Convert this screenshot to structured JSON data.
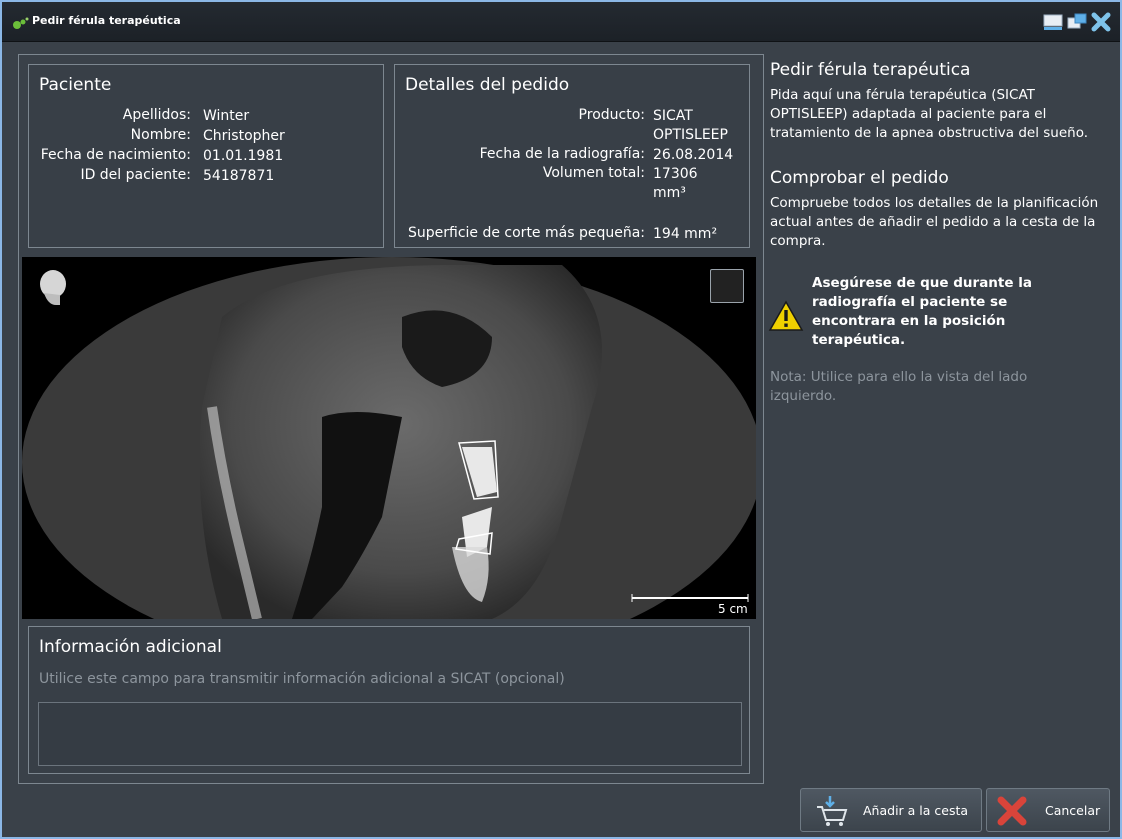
{
  "window": {
    "title": "Pedir férula terapéutica"
  },
  "patient": {
    "heading": "Paciente",
    "rows": [
      {
        "label": "Apellidos:",
        "value": "Winter"
      },
      {
        "label": "Nombre:",
        "value": "Christopher"
      },
      {
        "label": "Fecha de nacimiento:",
        "value": "01.01.1981"
      },
      {
        "label": "ID del paciente:",
        "value": "54187871"
      }
    ]
  },
  "order": {
    "heading": "Detalles del pedido",
    "product_label": "Producto:",
    "product_value_1": "SICAT",
    "product_value_2": "OPTISLEEP",
    "xray_date_label": "Fecha de la radiografía:",
    "xray_date_value": "26.08.2014",
    "volume_label": "Volumen total:",
    "volume_value_1": "17306",
    "volume_value_2": "mm³",
    "section_label": "Superficie de corte más pequeña:",
    "section_value": "194 mm²"
  },
  "viewer": {
    "scale_label": "5 cm"
  },
  "additional": {
    "heading": "Información adicional",
    "hint": "Utilice este campo para transmitir información adicional a SICAT (opcional)",
    "value": ""
  },
  "help": {
    "heading1": "Pedir férula terapéutica",
    "text1": "Pida aquí una férula terapéutica (SICAT OPTISLEEP) adaptada al paciente para el tratamiento de la apnea obstructiva del sueño.",
    "heading2": "Comprobar el pedido",
    "text2": "Compruebe todos los detalles de la planificación actual antes de añadir el pedido a la cesta de la compra.",
    "warning": "Asegúrese de que durante la radiografía el paciente se encontrara en la posición terapéutica.",
    "note": "Nota: Utilice para ello la vista del lado izquierdo."
  },
  "buttons": {
    "add_to_cart": "Añadir a la cesta",
    "cancel": "Cancelar"
  },
  "colors": {
    "window_border": "#8bb7e6",
    "background": "#3a4149",
    "warning": "#f0d000",
    "cancel_red": "#d9443a"
  }
}
